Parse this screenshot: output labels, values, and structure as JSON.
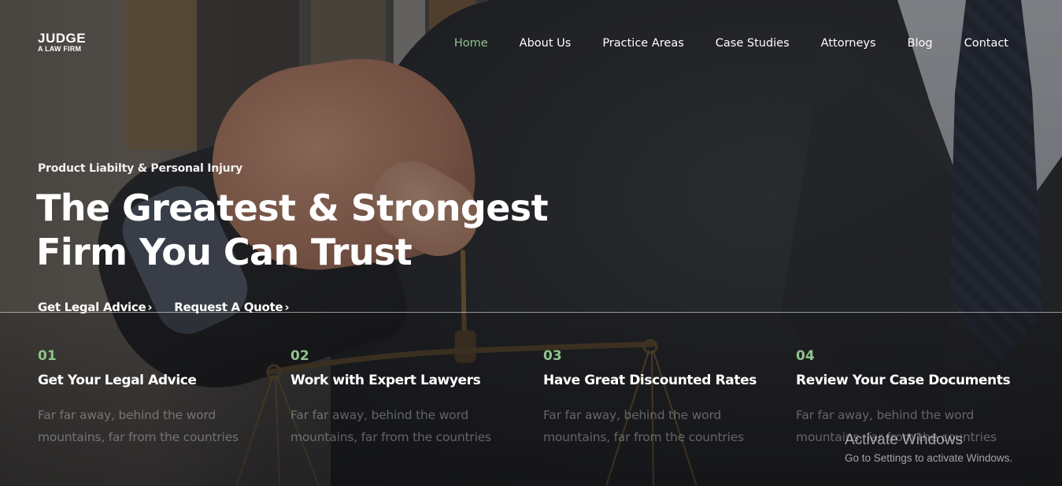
{
  "brand": {
    "name": "JUDGE",
    "tagline": "A LAW FIRM"
  },
  "nav": {
    "items": [
      {
        "label": "Home",
        "active": true
      },
      {
        "label": "About Us",
        "active": false
      },
      {
        "label": "Practice Areas",
        "active": false
      },
      {
        "label": "Case Studies",
        "active": false
      },
      {
        "label": "Attorneys",
        "active": false
      },
      {
        "label": "Blog",
        "active": false
      },
      {
        "label": "Contact",
        "active": false
      }
    ]
  },
  "hero": {
    "subtitle": "Product Liabilty & Personal Injury",
    "title_line1": "The Greatest & Strongest",
    "title_line2": "Firm You Can Trust",
    "links": [
      {
        "label": "Get Legal Advice",
        "icon": "chevron-right-icon"
      },
      {
        "label": "Request A Quote",
        "icon": "chevron-right-icon"
      }
    ]
  },
  "features": [
    {
      "number": "01",
      "title": "Get Your Legal Advice",
      "text": "Far far away, behind the word mountains, far from the countries"
    },
    {
      "number": "02",
      "title": "Work with Expert Lawyers",
      "text": "Far far away, behind the word mountains, far from the countries"
    },
    {
      "number": "03",
      "title": "Have Great Discounted Rates",
      "text": "Far far away, behind the word mountains, far from the countries"
    },
    {
      "number": "04",
      "title": "Review Your Case Documents",
      "text": "Far far away, behind the word mountains, far from the countries"
    }
  ],
  "watermark": {
    "title": "Activate Windows",
    "subtitle": "Go to Settings to activate Windows."
  },
  "colors": {
    "accent": "#8ec38b",
    "text": "#ffffff",
    "muted_text": "rgba(255,255,255,0.33)",
    "overlay": "rgba(20,20,22,0.42)"
  }
}
